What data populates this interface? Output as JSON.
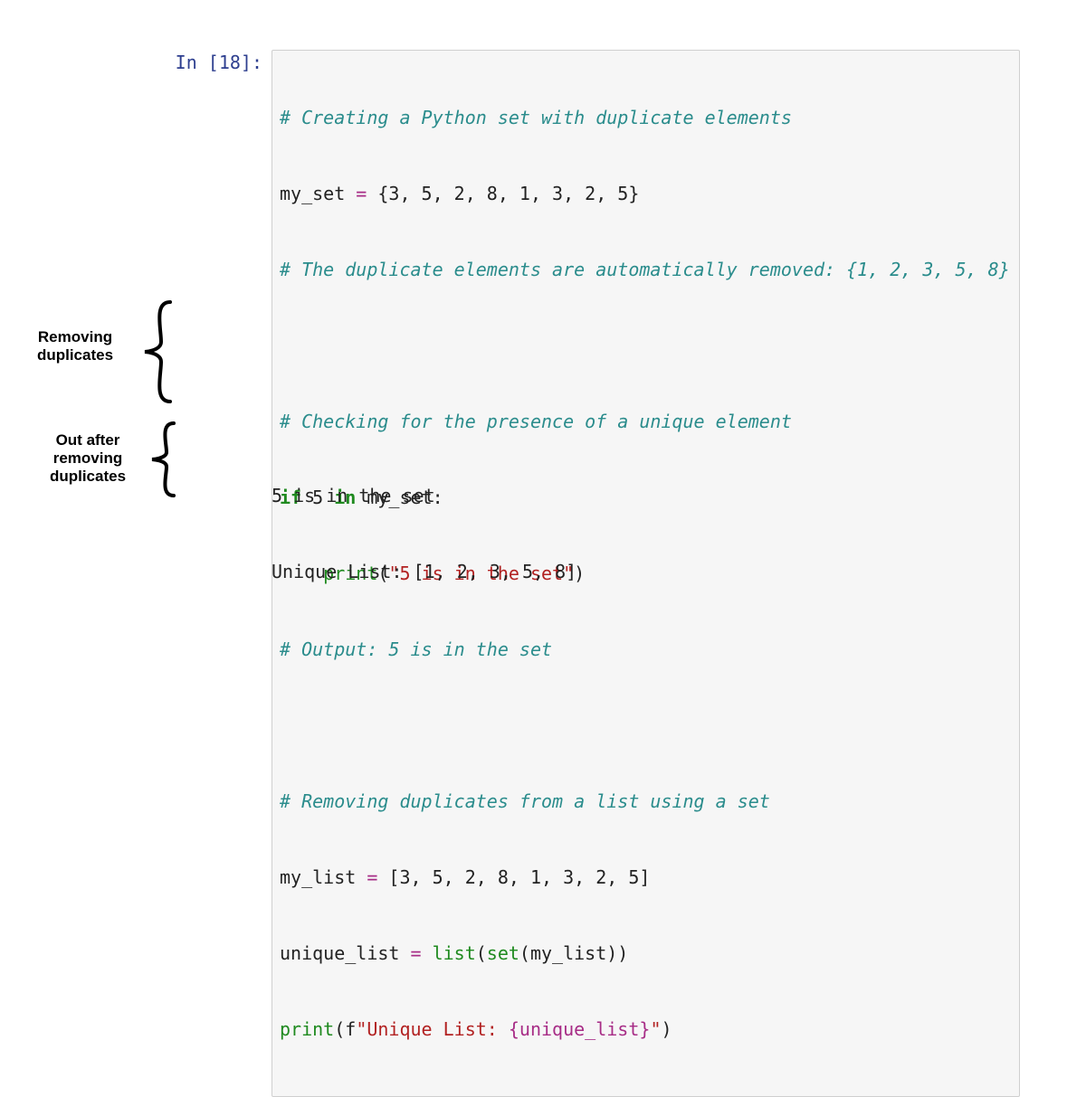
{
  "cell": {
    "prompt": "In [18]:",
    "code": {
      "l1": {
        "comment": "# Creating a Python set with duplicate elements"
      },
      "l2": {
        "lhs": "my_set",
        "eq": " = ",
        "rhs": "{3, 5, 2, 8, 1, 3, 2, 5}"
      },
      "l3": {
        "comment": "# The duplicate elements are automatically removed: {1, 2, 3, 5, 8}"
      },
      "l4": {
        "blank": " "
      },
      "l5": {
        "comment": "# Checking for the presence of a unique element"
      },
      "l6": {
        "kw_if": "if",
        "mid": " 5 ",
        "kw_in": "in",
        "tail": " my_set:"
      },
      "l7": {
        "indent": "    ",
        "fn": "print",
        "open": "(",
        "str": "\"5 is in the set\"",
        "close": ")"
      },
      "l8": {
        "comment": "# Output: 5 is in the set"
      },
      "l9": {
        "blank": " "
      },
      "l10": {
        "comment": "# Removing duplicates from a list using a set"
      },
      "l11": {
        "lhs": "my_list",
        "eq": " = ",
        "rhs": "[3, 5, 2, 8, 1, 3, 2, 5]"
      },
      "l12": {
        "lhs": "unique_list",
        "eq": " = ",
        "fn1": "list",
        "p1": "(",
        "fn2": "set",
        "p2": "(my_list))"
      },
      "l13": {
        "fn": "print",
        "p1": "(f",
        "str_a": "\"Unique List: ",
        "interp": "{unique_list}",
        "str_b": "\"",
        "p2": ")"
      }
    },
    "output": {
      "line1": "5 is in the set",
      "line2": "Unique List: [1, 2, 3, 5, 8]"
    }
  },
  "annotations": {
    "removing_line1": "Removing",
    "removing_line2": "duplicates",
    "outafter_line1": "Out after",
    "outafter_line2": "removing",
    "outafter_line3": "duplicates"
  }
}
